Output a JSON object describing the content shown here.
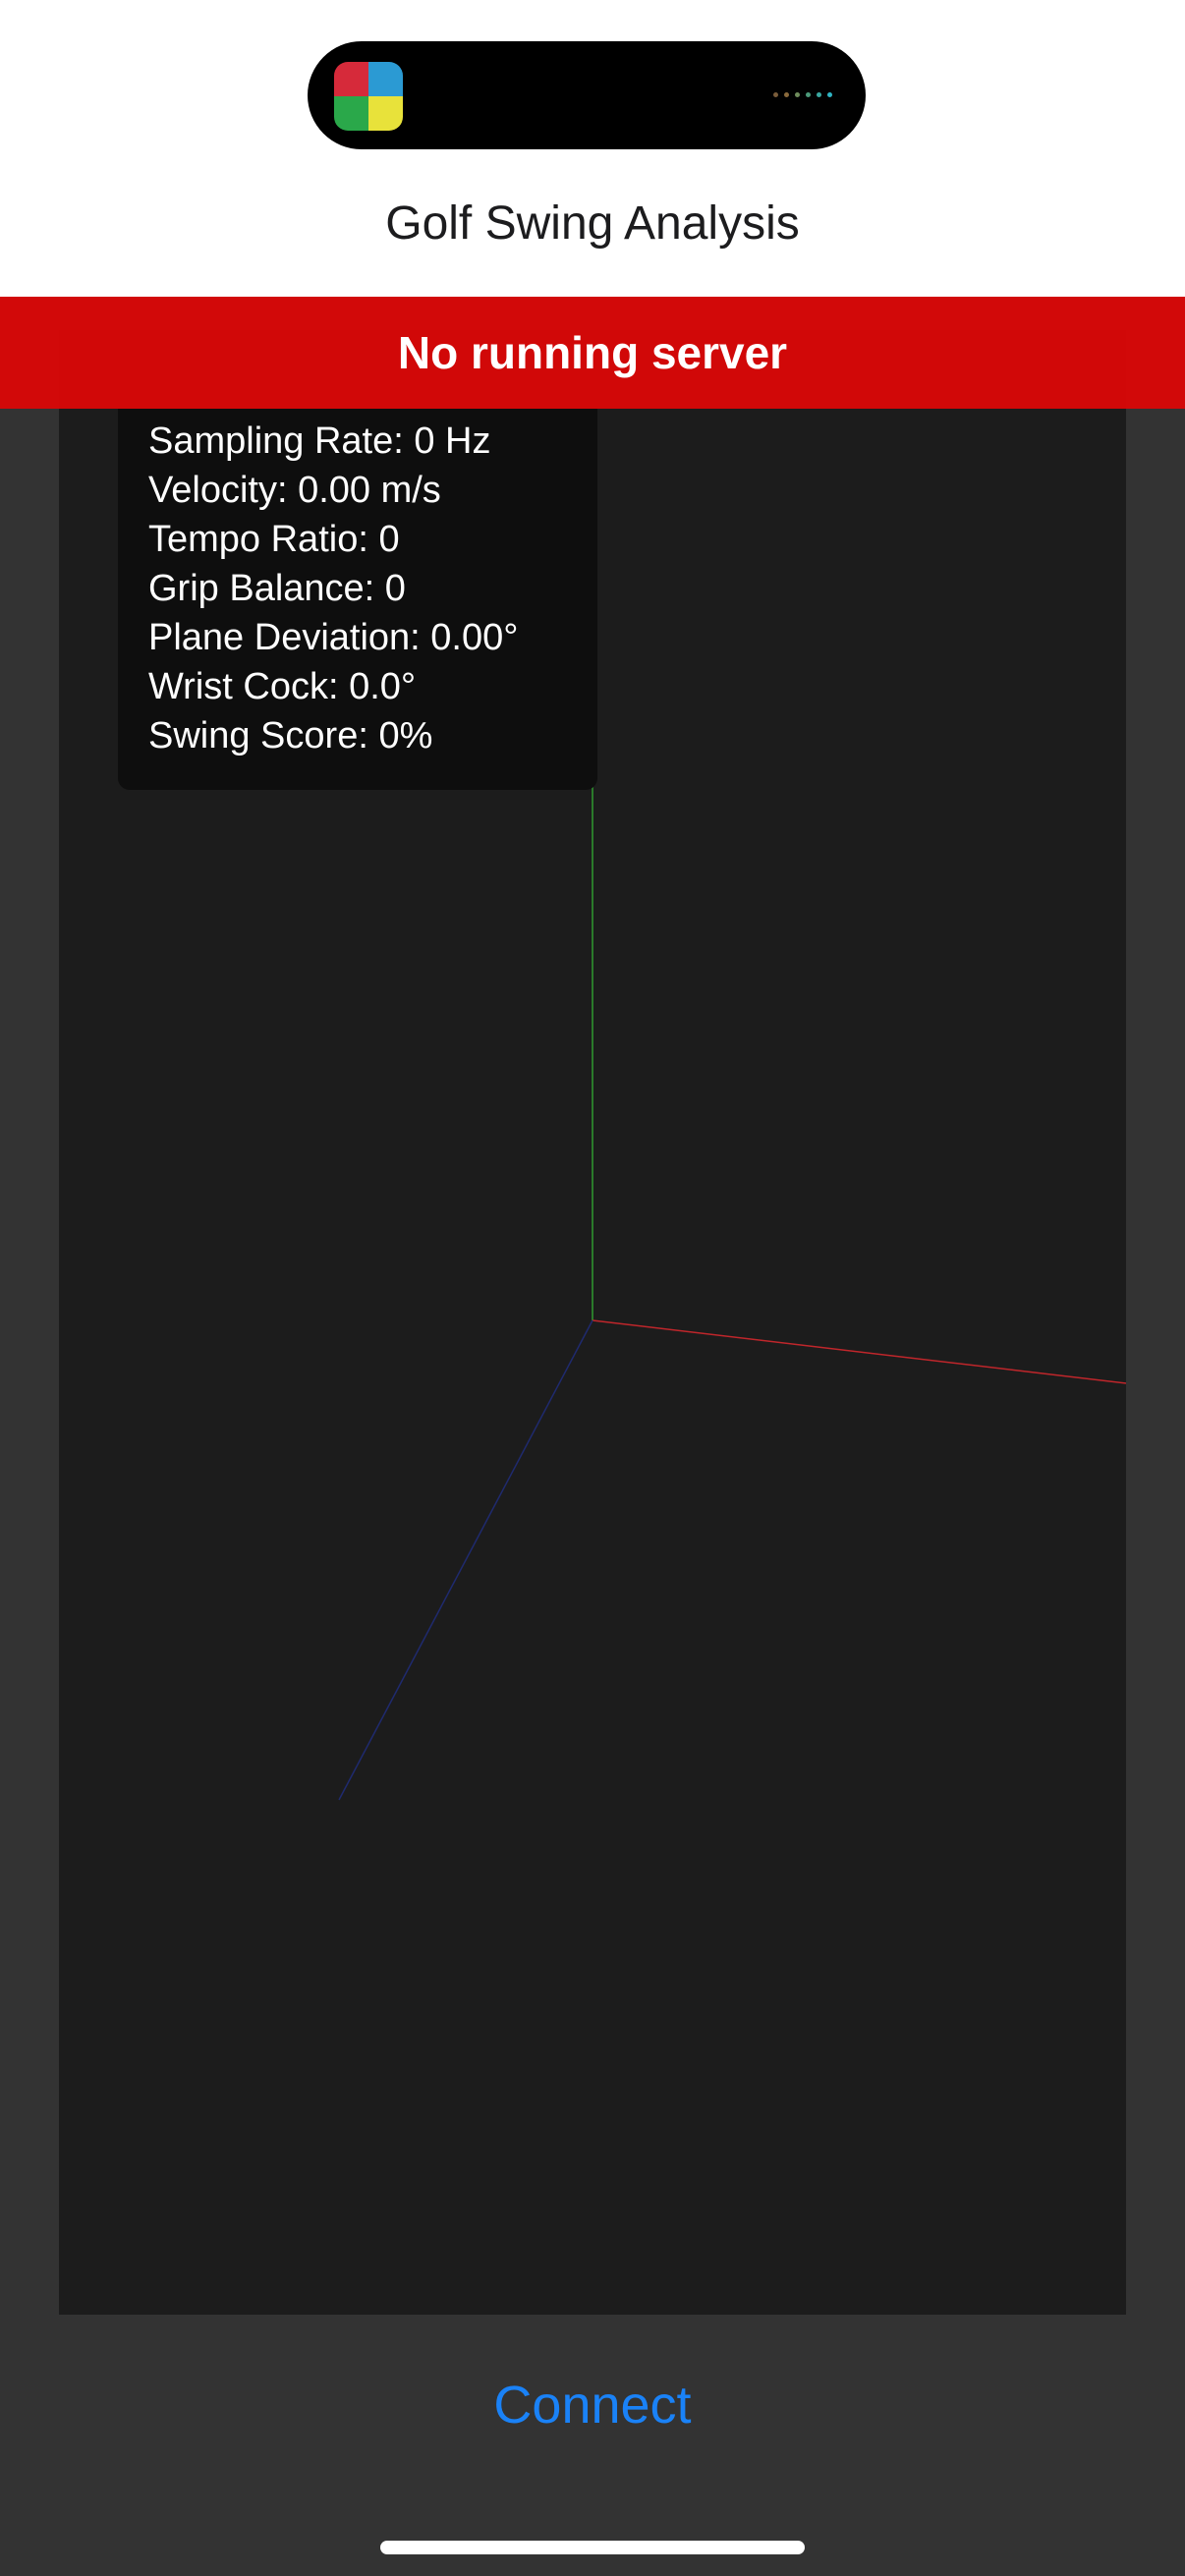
{
  "status_bar": {
    "app_icon": "color-quadrant-app-icon",
    "activity_indicator": "dots-icon",
    "dot_colors": [
      "#7a5c3a",
      "#8a6a3c",
      "#6f8d5c",
      "#4c9a7a",
      "#3aa7a0",
      "#2fb5c4"
    ]
  },
  "header": {
    "title": "Golf Swing Analysis"
  },
  "banner": {
    "message": "No running server",
    "color": "#d80808"
  },
  "stats": {
    "sampling_rate": "Sampling Rate: 0 Hz",
    "velocity": "Velocity: 0.00 m/s",
    "tempo_ratio": "Tempo Ratio: 0",
    "grip_balance": "Grip Balance: 0",
    "plane_deviation": "Plane Deviation: 0.00°",
    "wrist_cock": "Wrist Cock: 0.0°",
    "swing_score": "Swing Score: 0%"
  },
  "axes": {
    "x_color": "#c0262b",
    "y_color": "#2e9a2e",
    "z_color": "#1f2a6e"
  },
  "actions": {
    "connect_label": "Connect",
    "connect_color": "#1a82f7"
  }
}
